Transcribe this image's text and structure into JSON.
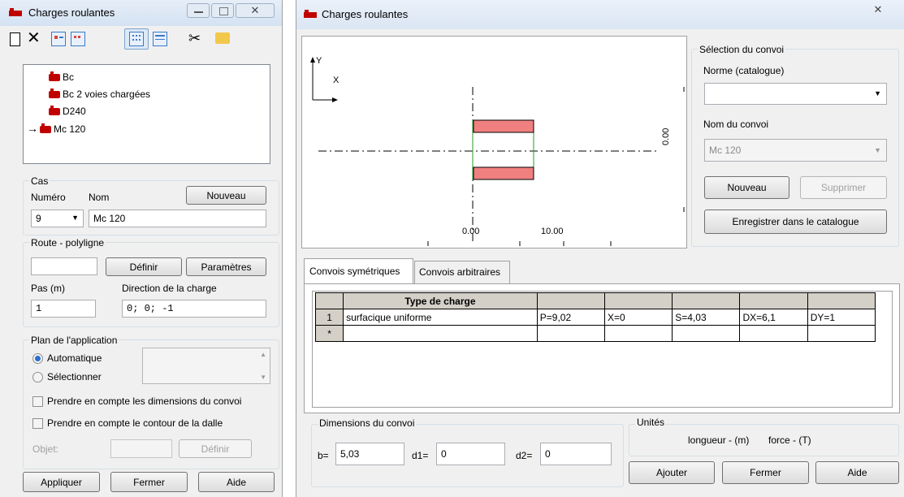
{
  "left_window": {
    "title": "Charges roulantes",
    "tree_items": [
      "Bc",
      "Bc 2 voies chargées",
      "D240",
      "Mc 120"
    ],
    "cas": {
      "group_label": "Cas",
      "numero_label": "Numéro",
      "nom_label": "Nom",
      "nouveau_button": "Nouveau",
      "numero_value": "9",
      "nom_value": "Mc 120"
    },
    "route": {
      "group_label": "Route - polyligne",
      "definir_button": "Définir",
      "parametres_button": "Paramètres",
      "pas_label": "Pas (m)",
      "direction_label": "Direction de la charge",
      "pas_value": "1",
      "direction_value": "0; 0; -1"
    },
    "plan": {
      "group_label": "Plan de l'application",
      "automatique": "Automatique",
      "selectionner": "Sélectionner",
      "check_dimensions": "Prendre en compte les dimensions du convoi",
      "check_contour": "Prendre en compte le contour de la dalle",
      "objet_label": "Objet:",
      "definir_button": "Définir"
    },
    "footer": {
      "appliquer": "Appliquer",
      "fermer": "Fermer",
      "aide": "Aide"
    }
  },
  "right_window": {
    "title": "Charges roulantes",
    "preview": {
      "axis_y": "Y",
      "axis_x": "X",
      "label_zero": "0.00",
      "label_ten": "10.00",
      "label_vertical": "0.00"
    },
    "selection": {
      "group_label": "Sélection du convoi",
      "norme_label": "Norme (catalogue)",
      "norme_value": "",
      "nom_label": "Nom du convoi",
      "nom_value": "Mc 120",
      "nouveau_button": "Nouveau",
      "supprimer_button": "Supprimer",
      "enregistrer_button": "Enregistrer dans le catalogue"
    },
    "tabs": [
      "Convois symétriques",
      "Convois arbitraires"
    ],
    "table": {
      "header": "Type de charge",
      "rows": [
        {
          "num": "1",
          "type": "surfacique uniforme",
          "p": "P=9,02",
          "x": "X=0",
          "s": "S=4,03",
          "dx": "DX=6,1",
          "dy": "DY=1"
        },
        {
          "num": "*",
          "type": "",
          "p": "",
          "x": "",
          "s": "",
          "dx": "",
          "dy": ""
        }
      ]
    },
    "dimensions": {
      "group_label": "Dimensions du convoi",
      "b_label": "b=",
      "b_value": "5,03",
      "d1_label": "d1=",
      "d1_value": "0",
      "d2_label": "d2=",
      "d2_value": "0"
    },
    "unites": {
      "group_label": "Unités",
      "longueur": "longueur - (m)",
      "force": "force - (T)"
    },
    "footer": {
      "ajouter": "Ajouter",
      "fermer": "Fermer",
      "aide": "Aide"
    }
  },
  "colors": {
    "load_rect": "#f08080",
    "accent_blue": "#2b6fcf"
  }
}
